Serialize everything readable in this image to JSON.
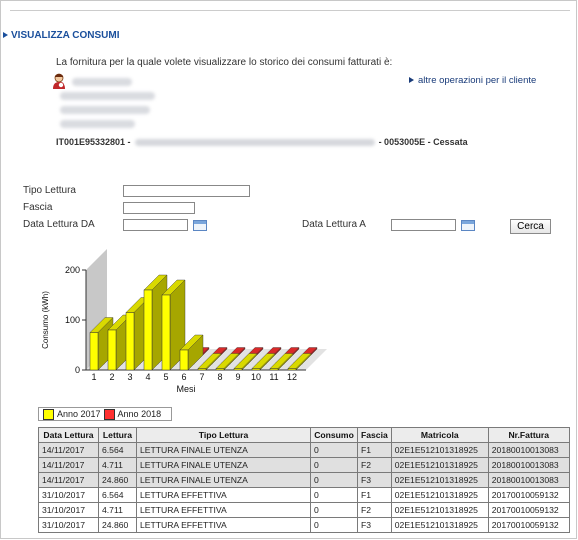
{
  "header": {
    "title": "VISUALIZZA CONSUMI"
  },
  "intro_text": "La fornitura per la quale volete visualizzare lo storico dei consumi fatturati è:",
  "other_ops_link": "altre operazioni per il cliente",
  "pod": {
    "code": "IT001E95332801 -",
    "suffix": "- 0053005E - Cessata"
  },
  "filters": {
    "tipo_lettura_label": "Tipo Lettura",
    "fascia_label": "Fascia",
    "data_da_label": "Data Lettura DA",
    "data_a_label": "Data Lettura A",
    "search_button": "Cerca"
  },
  "chart_data": {
    "type": "bar",
    "ylabel": "Consumo (kWh)",
    "xlabel": "Mesi",
    "categories": [
      "1",
      "2",
      "3",
      "4",
      "5",
      "6",
      "7",
      "8",
      "9",
      "10",
      "11",
      "12"
    ],
    "ylim": [
      0,
      200
    ],
    "yticks": [
      "0",
      "100",
      "200"
    ],
    "series": [
      {
        "name": "Anno 2017",
        "color": "#ffff00",
        "values": [
          75,
          80,
          115,
          160,
          150,
          40,
          0,
          0,
          0,
          0,
          0,
          0
        ]
      },
      {
        "name": "Anno 2018",
        "color": "#ff3030",
        "values": [
          0,
          0,
          0,
          0,
          0,
          0,
          0,
          0,
          0,
          0,
          0,
          0
        ]
      }
    ]
  },
  "table": {
    "columns": [
      "Data Lettura",
      "Lettura",
      "Tipo Lettura",
      "Consumo",
      "Fascia",
      "Matricola",
      "Nr.Fattura"
    ],
    "rows": [
      [
        "14/11/2017",
        "6.564",
        "LETTURA FINALE UTENZA",
        "0",
        "F1",
        "02E1E512101318925",
        "20180010013083"
      ],
      [
        "14/11/2017",
        "4.711",
        "LETTURA FINALE UTENZA",
        "0",
        "F2",
        "02E1E512101318925",
        "20180010013083"
      ],
      [
        "14/11/2017",
        "24.860",
        "LETTURA FINALE UTENZA",
        "0",
        "F3",
        "02E1E512101318925",
        "20180010013083"
      ],
      [
        "31/10/2017",
        "6.564",
        "LETTURA EFFETTIVA",
        "0",
        "F1",
        "02E1E512101318925",
        "20170010059132"
      ],
      [
        "31/10/2017",
        "4.711",
        "LETTURA EFFETTIVA",
        "0",
        "F2",
        "02E1E512101318925",
        "20170010059132"
      ],
      [
        "31/10/2017",
        "24.860",
        "LETTURA EFFETTIVA",
        "0",
        "F3",
        "02E1E512101318925",
        "20170010059132"
      ]
    ]
  }
}
